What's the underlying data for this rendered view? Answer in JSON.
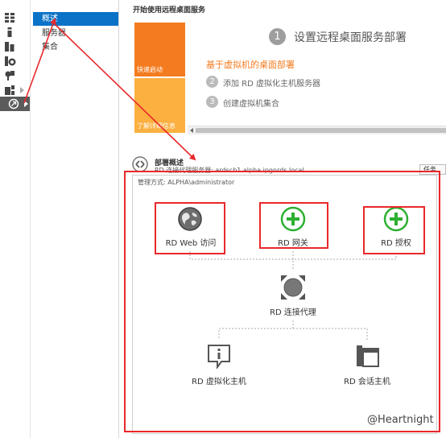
{
  "nav": {
    "items": [
      {
        "label": "概述",
        "selected": true
      },
      {
        "label": "服务器",
        "selected": false
      },
      {
        "label": "集合",
        "selected": false
      }
    ]
  },
  "rail": {
    "icons": [
      "dashboard-icon",
      "local-server-icon",
      "all-servers-icon",
      "iis-icon",
      "file-services-icon",
      "roles-icon",
      "remote-desktop-icon"
    ]
  },
  "quickstart": {
    "section_title": "开始使用远程桌面服务",
    "tile_quick": "快速启动",
    "tile_learn": "了解详细信息",
    "step1_num": "1",
    "step1_text": "设置远程桌面服务部署",
    "subtitle": "基于虚拟机的桌面部署",
    "step2_num": "2",
    "step2_text": "添加 RD 虚拟化主机服务器",
    "step3_num": "3",
    "step3_text": "创建虚拟机集合"
  },
  "deployment": {
    "title": "部署概述",
    "subtitle": "RD 连接代理服务器: ardscb1.alpha.ipgnrds.local",
    "tasks": "任务",
    "managed_by": "管理方式: ALPHA\\administrator"
  },
  "diagram": {
    "web_access": "RD Web 访问",
    "gateway": "RD 网关",
    "licensing": "RD 授权",
    "broker": "RD 连接代理",
    "virtualization_host": "RD 虚拟化主机",
    "session_host": "RD 会话主机"
  },
  "watermark": "@Heartnight",
  "colors": {
    "accent_blue": "#0a72c7",
    "tile_orange": "#f47c20",
    "tile_light_orange": "#fbb040",
    "green": "#2db032",
    "annotation_red": "#e8282b"
  }
}
